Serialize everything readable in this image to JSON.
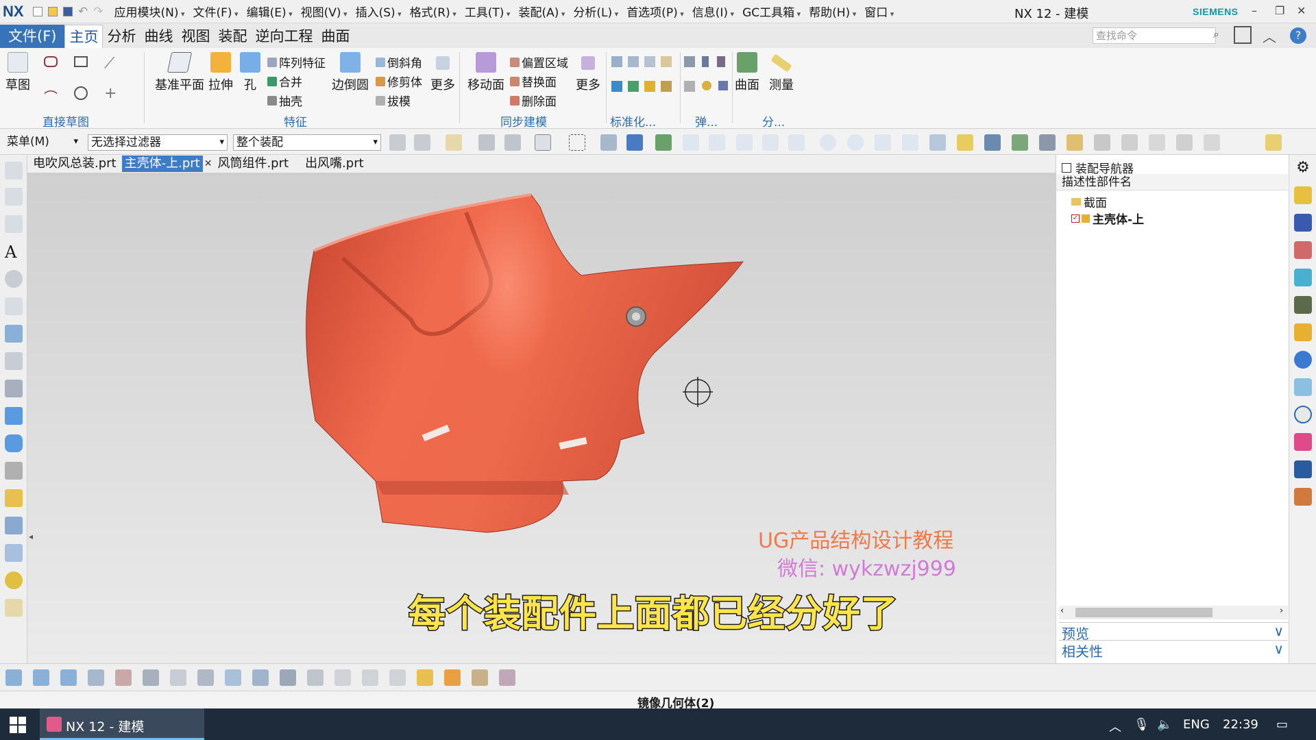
{
  "app": {
    "logo": "NX",
    "window_title": "NX 12 - 建模",
    "brand": "SIEMENS"
  },
  "menubar": [
    "应用模块(N)",
    "文件(F)",
    "编辑(E)",
    "视图(V)",
    "插入(S)",
    "格式(R)",
    "工具(T)",
    "装配(A)",
    "分析(L)",
    "首选项(P)",
    "信息(I)",
    "GC工具箱",
    "帮助(H)",
    "窗口"
  ],
  "ribbon_tabs": [
    "文件(F)",
    "主页",
    "分析",
    "曲线",
    "视图",
    "装配",
    "逆向工程",
    "曲面"
  ],
  "search_placeholder": "查找命令",
  "ribbon": {
    "sketch": "草图",
    "datum_plane": "基准平面",
    "extrude": "拉伸",
    "hole": "孔",
    "pattern_feature": "阵列特征",
    "unite": "合并",
    "shell": "抽壳",
    "edge_blend": "边倒圆",
    "chamfer": "倒斜角",
    "trim_body": "修剪体",
    "draft": "拔模",
    "more1": "更多",
    "move_face": "移动面",
    "offset_region": "偏置区域",
    "replace_face": "替换面",
    "delete_face": "删除面",
    "more2": "更多",
    "surface": "曲面",
    "measure": "测量",
    "groups": {
      "direct_sketch": "直接草图",
      "feature": "特征",
      "sync_modeling": "同步建模",
      "standard": "标准化...",
      "spring": "弹...",
      "analysis": "分..."
    }
  },
  "toolbar": {
    "menu": "菜单(M)",
    "filter": "无选择过滤器",
    "scope": "整个装配"
  },
  "doc_tabs": [
    {
      "label": "电吹风总装.prt"
    },
    {
      "label": "主壳体-上.prt"
    },
    {
      "label": "风筒组件.prt"
    },
    {
      "label": "出风嘴.prt"
    }
  ],
  "nav": {
    "title": "装配导航器",
    "column": "描述性部件名",
    "items": [
      "截面",
      "主壳体-上"
    ],
    "preview": "预览",
    "relevance": "相关性"
  },
  "overlay": {
    "watermark_line1": "UG产品结构设计教程",
    "watermark_line2": "微信: wykzwzj999",
    "subtitle": "每个装配件上面都已经分好了"
  },
  "status": {
    "text": "镜像几何体(2)"
  },
  "taskbar": {
    "app": "NX 12 - 建模",
    "lang": "ENG",
    "time": "22:39"
  },
  "colors": {
    "part": "#e8644a",
    "accent": "#3673b8",
    "siemens": "#0a9aa6"
  }
}
